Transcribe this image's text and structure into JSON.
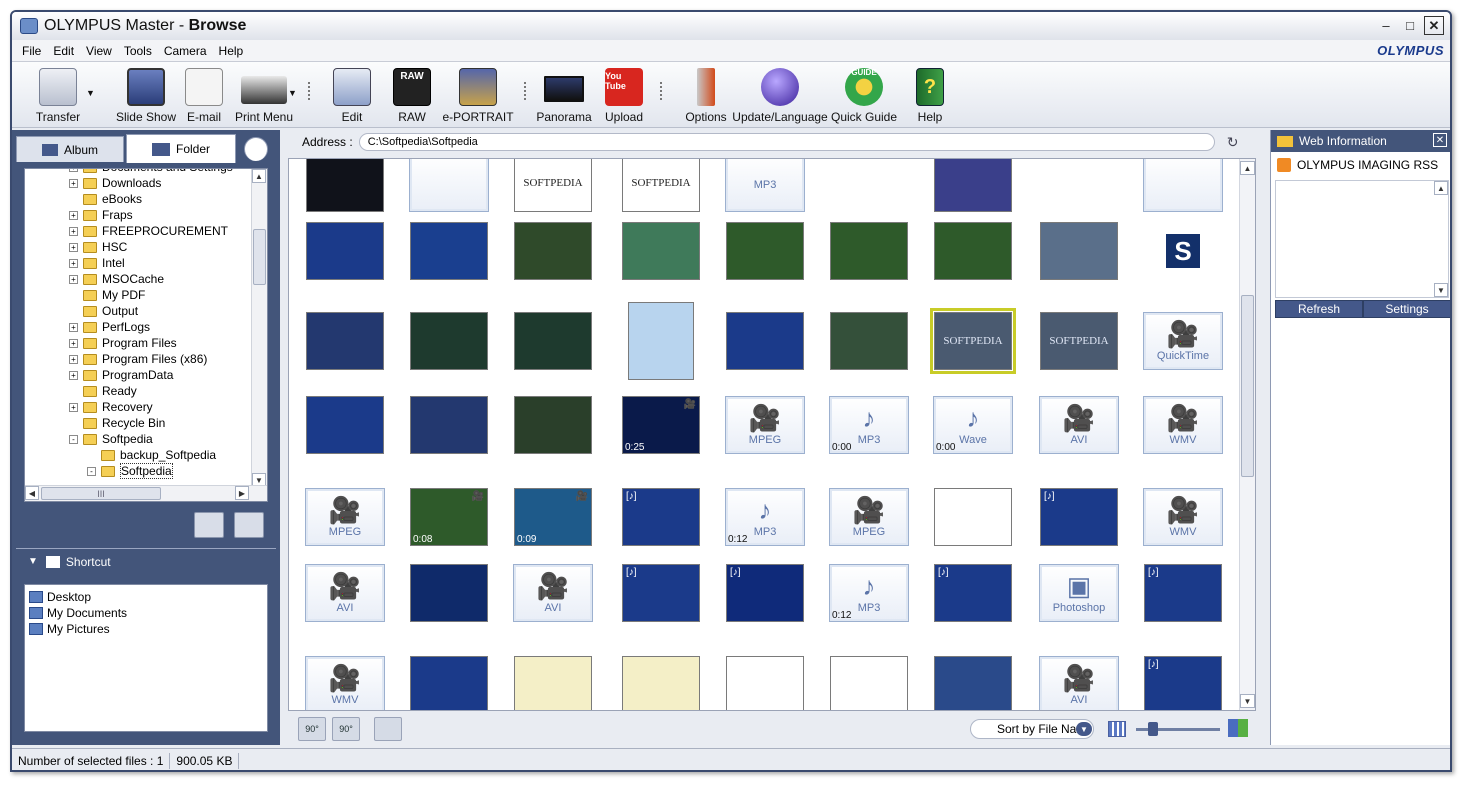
{
  "window": {
    "app_name": "OLYMPUS Master",
    "mode": "Browse",
    "brand": "OLYMPUS",
    "min_glyph": "–",
    "max_glyph": "□",
    "close_glyph": "✕"
  },
  "menu": [
    "File",
    "Edit",
    "View",
    "Tools",
    "Camera",
    "Help"
  ],
  "toolbar": [
    {
      "label": "Transfer",
      "icon": "camera-transfer-icon"
    },
    {
      "label": "Slide Show",
      "icon": "slideshow-icon"
    },
    {
      "label": "E-mail",
      "icon": "envelope-icon"
    },
    {
      "label": "Print Menu",
      "icon": "printer-icon"
    },
    {
      "label": "Edit",
      "icon": "edit-window-icon"
    },
    {
      "label": "RAW",
      "icon": "raw-icon"
    },
    {
      "label": "e-PORTRAIT",
      "icon": "portrait-icon"
    },
    {
      "label": "Panorama",
      "icon": "panorama-icon"
    },
    {
      "label": "Upload",
      "icon": "youtube-upload-icon"
    },
    {
      "label": "Options",
      "icon": "tools-icon"
    },
    {
      "label": "Update/Language",
      "icon": "globe-update-icon"
    },
    {
      "label": "Quick Guide",
      "icon": "clover-guide-icon"
    },
    {
      "label": "Help",
      "icon": "help-book-icon"
    }
  ],
  "toolbar_badges": {
    "raw": "RAW",
    "youtube": "You Tube",
    "guide": "GUIDE",
    "help": "?"
  },
  "left": {
    "tabs": {
      "album": "Album",
      "folder": "Folder"
    },
    "tree": [
      {
        "label": "Documents and Settings",
        "exp": "+"
      },
      {
        "label": "Downloads",
        "exp": "+"
      },
      {
        "label": "eBooks",
        "exp": ""
      },
      {
        "label": "Fraps",
        "exp": "+"
      },
      {
        "label": "FREEPROCUREMENT",
        "exp": "+"
      },
      {
        "label": "HSC",
        "exp": "+"
      },
      {
        "label": "Intel",
        "exp": "+"
      },
      {
        "label": "MSOCache",
        "exp": "+"
      },
      {
        "label": "My PDF",
        "exp": ""
      },
      {
        "label": "Output",
        "exp": ""
      },
      {
        "label": "PerfLogs",
        "exp": "+"
      },
      {
        "label": "Program Files",
        "exp": "+"
      },
      {
        "label": "Program Files (x86)",
        "exp": "+"
      },
      {
        "label": "ProgramData",
        "exp": "+"
      },
      {
        "label": "Ready",
        "exp": ""
      },
      {
        "label": "Recovery",
        "exp": "+"
      },
      {
        "label": "Recycle Bin",
        "exp": ""
      },
      {
        "label": "Softpedia",
        "exp": "-"
      },
      {
        "label": "backup_Softpedia",
        "exp": ""
      },
      {
        "label": "Softpedia",
        "exp": "-"
      }
    ],
    "tree_hs_glyph": "III",
    "shortcut_title": "Shortcut",
    "shortcut_toggle": "▼",
    "shortcuts": [
      "Desktop",
      "My Documents",
      "My Pictures"
    ]
  },
  "address": {
    "label": "Address :",
    "value": "C:\\Softpedia\\Softpedia",
    "go_glyph": "↻"
  },
  "thumbs": [
    {
      "k": "t",
      "bg": "#10121a"
    },
    {
      "k": "f",
      "t": ""
    },
    {
      "k": "t",
      "bg": "#ffffff",
      "txt": "SOFTPEDIA"
    },
    {
      "k": "t",
      "bg": "#ffffff",
      "txt": "SOFTPEDIA"
    },
    {
      "k": "f",
      "t": "MP3"
    },
    {
      "k": "e"
    },
    {
      "k": "t",
      "bg": "#3a3f8a"
    },
    {
      "k": "e"
    },
    {
      "k": "f",
      "t": ""
    },
    {
      "k": "t",
      "bg": "#1b3a8a"
    },
    {
      "k": "t",
      "bg": "#1a3f8f"
    },
    {
      "k": "t",
      "bg": "#2f4a2a"
    },
    {
      "k": "t",
      "bg": "#3f7a5a"
    },
    {
      "k": "t",
      "bg": "#2e5a2a"
    },
    {
      "k": "t",
      "bg": "#2e5a2a"
    },
    {
      "k": "t",
      "bg": "#2e5a2a"
    },
    {
      "k": "t",
      "bg": "#5a6f8a"
    },
    {
      "k": "s",
      "t": "S"
    },
    {
      "k": "t",
      "bg": "#23386f"
    },
    {
      "k": "t",
      "bg": "#1e3a2e"
    },
    {
      "k": "t",
      "bg": "#1e3a2e"
    },
    {
      "k": "t",
      "bg": "#b8d4ee"
    },
    {
      "k": "t",
      "bg": "#1b3a8a"
    },
    {
      "k": "t",
      "bg": "#34503a"
    },
    {
      "k": "t",
      "bg": "#4a5a70",
      "sel": true,
      "txt": "SOFTPEDIA"
    },
    {
      "k": "t",
      "bg": "#4a5a70",
      "txt": "SOFTPEDIA"
    },
    {
      "k": "f",
      "t": "QuickTime",
      "g": "🎥"
    },
    {
      "k": "t",
      "bg": "#1b3a8a"
    },
    {
      "k": "t",
      "bg": "#23386f"
    },
    {
      "k": "t",
      "bg": "#2a3f2a"
    },
    {
      "k": "t",
      "bg": "#0a1a4a",
      "dur": "0:25",
      "badge": "🎥"
    },
    {
      "k": "f",
      "t": "MPEG",
      "g": "🎥"
    },
    {
      "k": "f",
      "t": "MP3",
      "g": "♪",
      "dur": "0:00"
    },
    {
      "k": "f",
      "t": "Wave",
      "g": "♪",
      "dur": "0:00"
    },
    {
      "k": "f",
      "t": "AVI",
      "g": "🎥"
    },
    {
      "k": "f",
      "t": "WMV",
      "g": "🎥"
    },
    {
      "k": "f",
      "t": "MPEG",
      "g": "🎥"
    },
    {
      "k": "t",
      "bg": "#2e5a2a",
      "dur": "0:08",
      "badge": "🎥"
    },
    {
      "k": "t",
      "bg": "#1e5a8a",
      "dur": "0:09",
      "badge": "🎥"
    },
    {
      "k": "t",
      "bg": "#1b3a8a",
      "badge": "[♪]"
    },
    {
      "k": "f",
      "t": "MP3",
      "g": "♪",
      "dur": "0:12"
    },
    {
      "k": "f",
      "t": "MPEG",
      "g": "🎥"
    },
    {
      "k": "t",
      "bg": "#ffffff"
    },
    {
      "k": "t",
      "bg": "#1b3a8a",
      "badge": "[♪]"
    },
    {
      "k": "f",
      "t": "WMV",
      "g": "🎥"
    },
    {
      "k": "f",
      "t": "AVI",
      "g": "🎥"
    },
    {
      "k": "t",
      "bg": "#0f2a6a"
    },
    {
      "k": "f",
      "t": "AVI",
      "g": "🎥"
    },
    {
      "k": "t",
      "bg": "#1b3a8a",
      "badge": "[♪]"
    },
    {
      "k": "t",
      "bg": "#0f2a7a",
      "badge": "[♪]"
    },
    {
      "k": "f",
      "t": "MP3",
      "g": "♪",
      "dur": "0:12"
    },
    {
      "k": "t",
      "bg": "#1b3a8a",
      "badge": "[♪]"
    },
    {
      "k": "f",
      "t": "Photoshop",
      "g": "▣"
    },
    {
      "k": "t",
      "bg": "#1b3a8a",
      "badge": "[♪]"
    },
    {
      "k": "f",
      "t": "WMV",
      "g": "🎥"
    },
    {
      "k": "t",
      "bg": "#1b3a8a"
    },
    {
      "k": "t",
      "bg": "#f4efc7"
    },
    {
      "k": "t",
      "bg": "#f4efc7"
    },
    {
      "k": "t",
      "bg": "#ffffff"
    },
    {
      "k": "t",
      "bg": "#ffffff"
    },
    {
      "k": "t",
      "bg": "#2a4a8a"
    },
    {
      "k": "f",
      "t": "AVI",
      "g": "🎥"
    },
    {
      "k": "t",
      "bg": "#1b3a8a",
      "badge": "[♪]"
    }
  ],
  "bottom": {
    "rotate_left": "90°",
    "rotate_right": "90°",
    "sort_label": "Sort by File Nam",
    "sort_glyph": "▼"
  },
  "web": {
    "title": "Web Information",
    "rss_title": "OLYMPUS IMAGING RSS",
    "refresh": "Refresh",
    "settings": "Settings",
    "close_glyph": "✕"
  },
  "status": {
    "selected": "Number of selected files : 1",
    "size": "900.05 KB"
  },
  "scroll": {
    "up": "▲",
    "down": "▼",
    "left": "◀",
    "right": "▶"
  }
}
